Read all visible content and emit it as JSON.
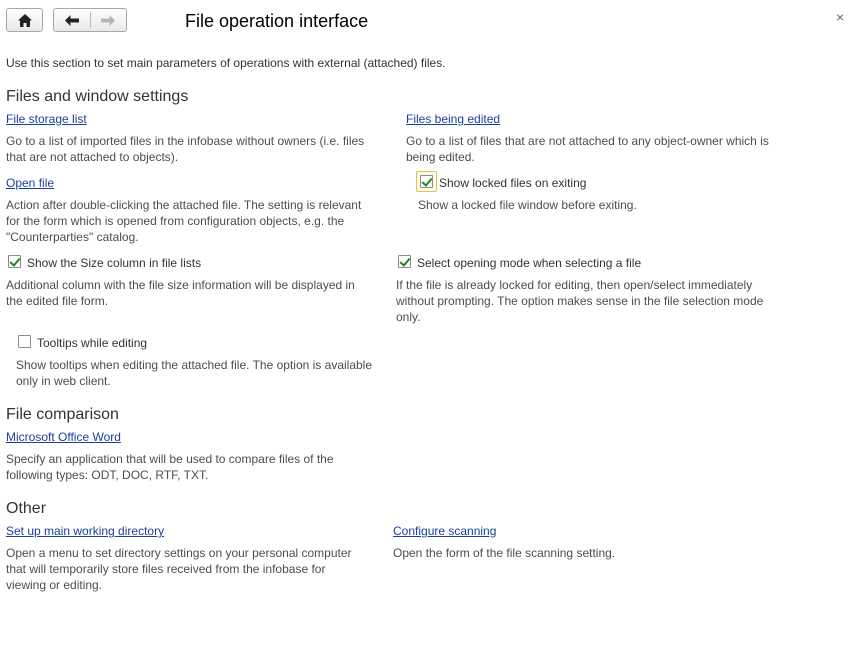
{
  "header": {
    "title": "File operation interface",
    "close_glyph": "×",
    "icons": {
      "home": "home-icon",
      "back": "arrow-left-icon",
      "forward": "arrow-right-icon",
      "close": "close-icon"
    }
  },
  "intro": "Use this section to set main parameters of operations with external (attached) files.",
  "sections": {
    "files_window": {
      "heading": "Files and window settings",
      "storage_list": {
        "link": "File storage list",
        "desc": [
          "Go to a list of imported files in the infobase without owners (i.e. files",
          "that are not attached to objects)."
        ]
      },
      "being_edited": {
        "link": "Files being edited",
        "desc": [
          "Go to a list of files that are not attached to any object-owner which is",
          "being edited."
        ]
      },
      "open_file": {
        "link": "Open file",
        "desc": [
          "Action after double-clicking the attached file. The setting is relevant",
          "for the form which is opened from configuration objects, e.g. the",
          "\"Counterparties\" catalog."
        ]
      },
      "show_locked": {
        "label": "Show locked files on exiting",
        "checked": true,
        "desc": "Show a locked file window before exiting."
      },
      "size_column": {
        "label": "Show the Size column in file lists",
        "checked": true,
        "desc": [
          "Additional column with the file size information will be displayed in",
          "the edited file form."
        ]
      },
      "opening_mode": {
        "label": "Select opening mode when selecting a file",
        "checked": true,
        "desc": [
          "If the file is already locked for editing, then open/select immediately",
          "without prompting. The option makes sense in the file selection mode",
          "only."
        ]
      },
      "tooltips": {
        "label": "Tooltips while editing",
        "checked": false,
        "desc": [
          "Show tooltips when editing the attached file. The option is available",
          "only in web client."
        ]
      }
    },
    "comparison": {
      "heading": "File comparison",
      "word": {
        "link": "Microsoft Office Word",
        "desc": [
          "Specify an application that will be used to compare files of the",
          "following types: ODT, DOC, RTF, TXT."
        ]
      }
    },
    "other": {
      "heading": "Other",
      "working_dir": {
        "link": "Set up main working directory",
        "desc": [
          "Open a menu to set directory settings on your personal computer",
          "that will temporarily store files received from the infobase for",
          "viewing or editing."
        ]
      },
      "scanning": {
        "link": "Configure scanning",
        "desc": "Open the form of the file scanning setting."
      }
    }
  },
  "colors": {
    "link": "#1c3f9e",
    "check": "#1a8a1a",
    "focus_border": "#e0c354",
    "text": "#4d4d4d"
  }
}
